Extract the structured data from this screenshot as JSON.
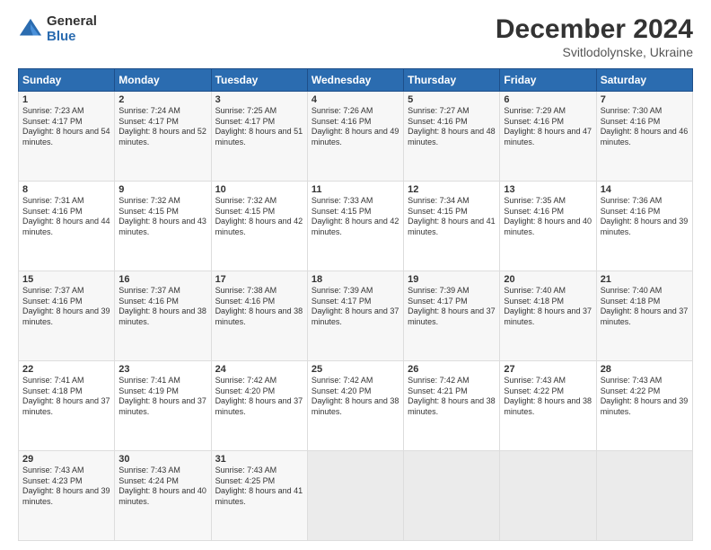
{
  "logo": {
    "general": "General",
    "blue": "Blue"
  },
  "header": {
    "month": "December 2024",
    "location": "Svitlodolynske, Ukraine"
  },
  "days_of_week": [
    "Sunday",
    "Monday",
    "Tuesday",
    "Wednesday",
    "Thursday",
    "Friday",
    "Saturday"
  ],
  "weeks": [
    [
      {
        "day": "1",
        "sunrise": "Sunrise: 7:23 AM",
        "sunset": "Sunset: 4:17 PM",
        "daylight": "Daylight: 8 hours and 54 minutes."
      },
      {
        "day": "2",
        "sunrise": "Sunrise: 7:24 AM",
        "sunset": "Sunset: 4:17 PM",
        "daylight": "Daylight: 8 hours and 52 minutes."
      },
      {
        "day": "3",
        "sunrise": "Sunrise: 7:25 AM",
        "sunset": "Sunset: 4:17 PM",
        "daylight": "Daylight: 8 hours and 51 minutes."
      },
      {
        "day": "4",
        "sunrise": "Sunrise: 7:26 AM",
        "sunset": "Sunset: 4:16 PM",
        "daylight": "Daylight: 8 hours and 49 minutes."
      },
      {
        "day": "5",
        "sunrise": "Sunrise: 7:27 AM",
        "sunset": "Sunset: 4:16 PM",
        "daylight": "Daylight: 8 hours and 48 minutes."
      },
      {
        "day": "6",
        "sunrise": "Sunrise: 7:29 AM",
        "sunset": "Sunset: 4:16 PM",
        "daylight": "Daylight: 8 hours and 47 minutes."
      },
      {
        "day": "7",
        "sunrise": "Sunrise: 7:30 AM",
        "sunset": "Sunset: 4:16 PM",
        "daylight": "Daylight: 8 hours and 46 minutes."
      }
    ],
    [
      {
        "day": "8",
        "sunrise": "Sunrise: 7:31 AM",
        "sunset": "Sunset: 4:16 PM",
        "daylight": "Daylight: 8 hours and 44 minutes."
      },
      {
        "day": "9",
        "sunrise": "Sunrise: 7:32 AM",
        "sunset": "Sunset: 4:15 PM",
        "daylight": "Daylight: 8 hours and 43 minutes."
      },
      {
        "day": "10",
        "sunrise": "Sunrise: 7:32 AM",
        "sunset": "Sunset: 4:15 PM",
        "daylight": "Daylight: 8 hours and 42 minutes."
      },
      {
        "day": "11",
        "sunrise": "Sunrise: 7:33 AM",
        "sunset": "Sunset: 4:15 PM",
        "daylight": "Daylight: 8 hours and 42 minutes."
      },
      {
        "day": "12",
        "sunrise": "Sunrise: 7:34 AM",
        "sunset": "Sunset: 4:15 PM",
        "daylight": "Daylight: 8 hours and 41 minutes."
      },
      {
        "day": "13",
        "sunrise": "Sunrise: 7:35 AM",
        "sunset": "Sunset: 4:16 PM",
        "daylight": "Daylight: 8 hours and 40 minutes."
      },
      {
        "day": "14",
        "sunrise": "Sunrise: 7:36 AM",
        "sunset": "Sunset: 4:16 PM",
        "daylight": "Daylight: 8 hours and 39 minutes."
      }
    ],
    [
      {
        "day": "15",
        "sunrise": "Sunrise: 7:37 AM",
        "sunset": "Sunset: 4:16 PM",
        "daylight": "Daylight: 8 hours and 39 minutes."
      },
      {
        "day": "16",
        "sunrise": "Sunrise: 7:37 AM",
        "sunset": "Sunset: 4:16 PM",
        "daylight": "Daylight: 8 hours and 38 minutes."
      },
      {
        "day": "17",
        "sunrise": "Sunrise: 7:38 AM",
        "sunset": "Sunset: 4:16 PM",
        "daylight": "Daylight: 8 hours and 38 minutes."
      },
      {
        "day": "18",
        "sunrise": "Sunrise: 7:39 AM",
        "sunset": "Sunset: 4:17 PM",
        "daylight": "Daylight: 8 hours and 37 minutes."
      },
      {
        "day": "19",
        "sunrise": "Sunrise: 7:39 AM",
        "sunset": "Sunset: 4:17 PM",
        "daylight": "Daylight: 8 hours and 37 minutes."
      },
      {
        "day": "20",
        "sunrise": "Sunrise: 7:40 AM",
        "sunset": "Sunset: 4:18 PM",
        "daylight": "Daylight: 8 hours and 37 minutes."
      },
      {
        "day": "21",
        "sunrise": "Sunrise: 7:40 AM",
        "sunset": "Sunset: 4:18 PM",
        "daylight": "Daylight: 8 hours and 37 minutes."
      }
    ],
    [
      {
        "day": "22",
        "sunrise": "Sunrise: 7:41 AM",
        "sunset": "Sunset: 4:18 PM",
        "daylight": "Daylight: 8 hours and 37 minutes."
      },
      {
        "day": "23",
        "sunrise": "Sunrise: 7:41 AM",
        "sunset": "Sunset: 4:19 PM",
        "daylight": "Daylight: 8 hours and 37 minutes."
      },
      {
        "day": "24",
        "sunrise": "Sunrise: 7:42 AM",
        "sunset": "Sunset: 4:20 PM",
        "daylight": "Daylight: 8 hours and 37 minutes."
      },
      {
        "day": "25",
        "sunrise": "Sunrise: 7:42 AM",
        "sunset": "Sunset: 4:20 PM",
        "daylight": "Daylight: 8 hours and 38 minutes."
      },
      {
        "day": "26",
        "sunrise": "Sunrise: 7:42 AM",
        "sunset": "Sunset: 4:21 PM",
        "daylight": "Daylight: 8 hours and 38 minutes."
      },
      {
        "day": "27",
        "sunrise": "Sunrise: 7:43 AM",
        "sunset": "Sunset: 4:22 PM",
        "daylight": "Daylight: 8 hours and 38 minutes."
      },
      {
        "day": "28",
        "sunrise": "Sunrise: 7:43 AM",
        "sunset": "Sunset: 4:22 PM",
        "daylight": "Daylight: 8 hours and 39 minutes."
      }
    ],
    [
      {
        "day": "29",
        "sunrise": "Sunrise: 7:43 AM",
        "sunset": "Sunset: 4:23 PM",
        "daylight": "Daylight: 8 hours and 39 minutes."
      },
      {
        "day": "30",
        "sunrise": "Sunrise: 7:43 AM",
        "sunset": "Sunset: 4:24 PM",
        "daylight": "Daylight: 8 hours and 40 minutes."
      },
      {
        "day": "31",
        "sunrise": "Sunrise: 7:43 AM",
        "sunset": "Sunset: 4:25 PM",
        "daylight": "Daylight: 8 hours and 41 minutes."
      },
      null,
      null,
      null,
      null
    ]
  ]
}
